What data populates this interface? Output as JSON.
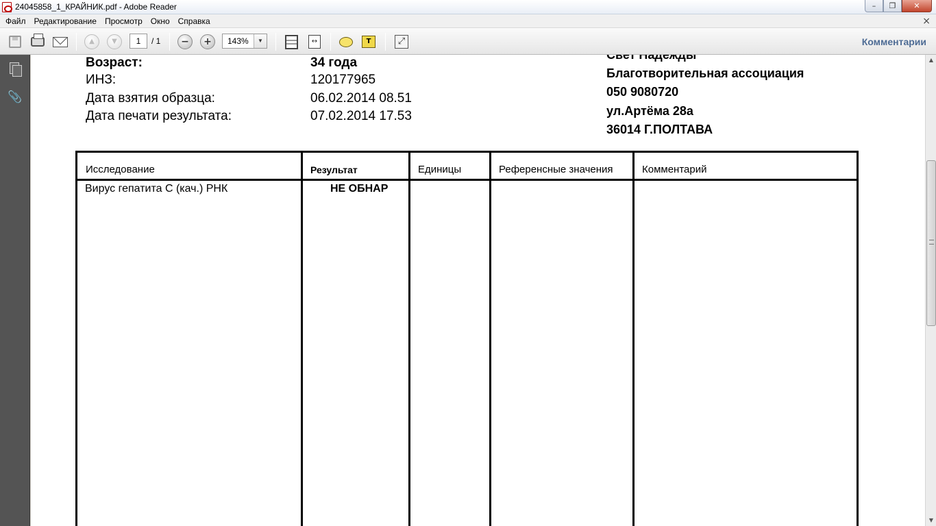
{
  "window": {
    "title": "24045858_1_КРАЙНИК.pdf - Adobe Reader",
    "minimize_glyph": "–",
    "restore_glyph": "❐",
    "close_glyph": "✕"
  },
  "menu": {
    "items": [
      "Файл",
      "Редактирование",
      "Просмотр",
      "Окно",
      "Справка"
    ],
    "close_glyph": "×"
  },
  "toolbar": {
    "page_current": "1",
    "page_total": "/ 1",
    "zoom": "143%",
    "zoom_arrow": "▼",
    "zoom_out_glyph": "−",
    "zoom_in_glyph": "+",
    "prev_glyph": "▲",
    "next_glyph": "▼",
    "fit_width_glyph": "↔",
    "expand_glyph": "⤢",
    "markup_glyph": "T",
    "comments_label": "Комментарии"
  },
  "leftnav": {
    "attach_glyph": "📎"
  },
  "scrollbar": {
    "up_glyph": "▲",
    "down_glyph": "▼"
  },
  "document": {
    "patient": {
      "age_label": "Возраст:",
      "age_value": "34 года",
      "inz_label": "ИНЗ:",
      "inz_value": "120177965",
      "sample_date_label": "Дата взятия образца:",
      "sample_date_value": "06.02.2014 08.51",
      "print_date_label": "Дата печати результата:",
      "print_date_value": "07.02.2014 17.53"
    },
    "organization": {
      "name": "Свет Надежды",
      "type": "Благотворительная ассоциация",
      "phone": "050 9080720",
      "street": "ул.Артёма 28а",
      "city": "36014 Г.ПОЛТАВА"
    },
    "table": {
      "headers": [
        "Исследование",
        "Результат",
        "Единицы",
        "Референсные значения",
        "Комментарий"
      ],
      "rows": [
        {
          "test": "Вирус гепатита С (кач.) РНК",
          "result": "НЕ ОБНАР",
          "units": "",
          "reference": "",
          "comment": ""
        }
      ]
    }
  }
}
